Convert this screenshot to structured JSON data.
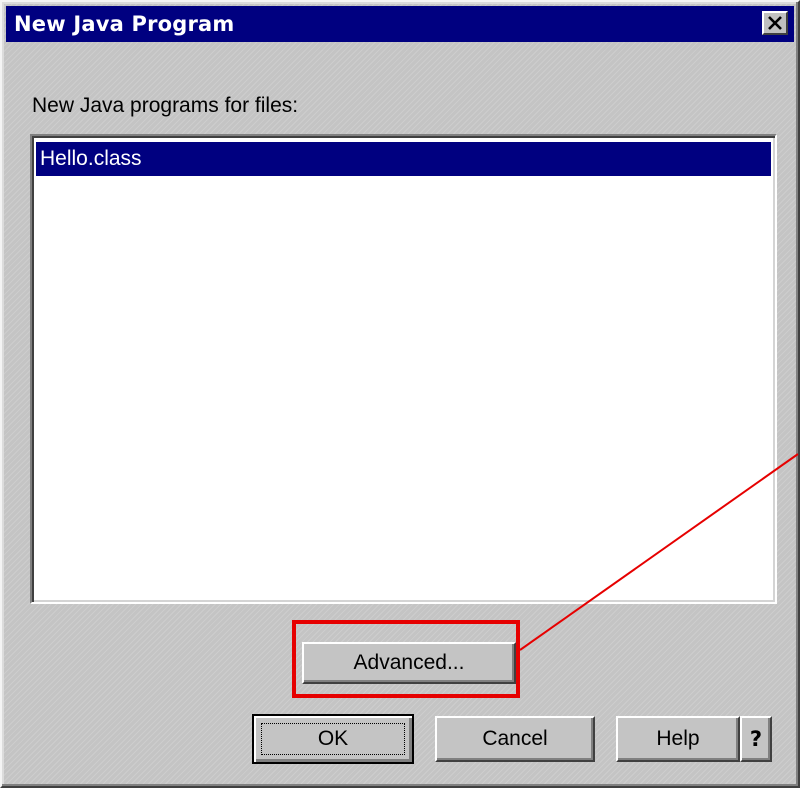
{
  "window": {
    "title": "New Java Program",
    "close_icon": "close-icon"
  },
  "content": {
    "list_label": "New Java programs for files:",
    "files": [
      {
        "name": "Hello.class",
        "selected": true
      }
    ]
  },
  "buttons": {
    "advanced": "Advanced...",
    "ok": "OK",
    "cancel": "Cancel",
    "help": "Help",
    "help_question": "?"
  },
  "colors": {
    "titlebar": "#000080",
    "selection": "#000080",
    "annotation": "#e60000",
    "dialog_background": "#c4c4c4"
  }
}
